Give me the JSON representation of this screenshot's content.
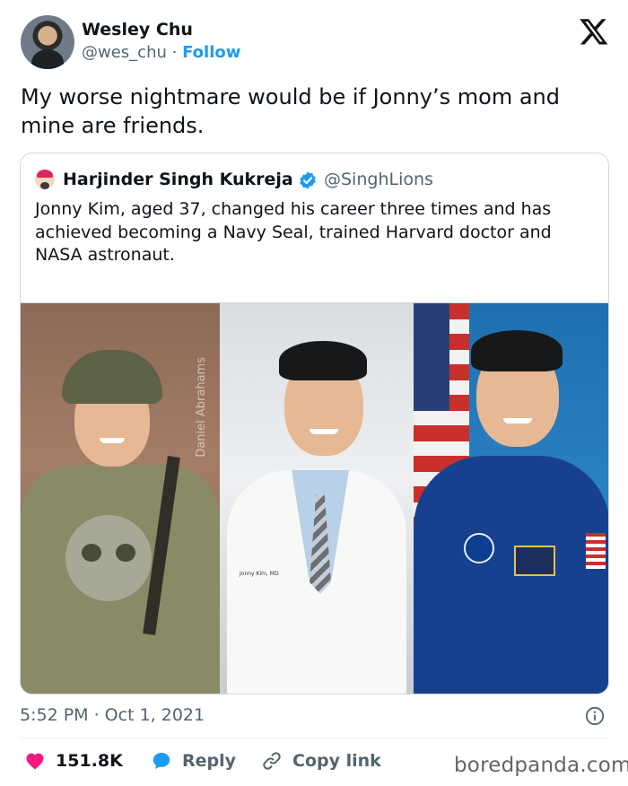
{
  "author": {
    "name": "Wesley Chu",
    "handle": "@wes_chu",
    "separator": "·",
    "follow_label": "Follow"
  },
  "tweet": {
    "text": "My worse nightmare would be if Jonny’s mom and mine are friends."
  },
  "quoted_tweet": {
    "name": "Harjinder Singh Kukreja",
    "handle": "@SinghLions",
    "text": "Jonny Kim, aged 37, changed his career three times and has achieved becoming a Navy Seal, trained Harvard doctor and NASA astronaut.",
    "photo_watermark": "Daniel Abrahams",
    "coat_label": "Jonny Kim, MD"
  },
  "meta": {
    "timestamp": "5:52 PM · Oct 1, 2021"
  },
  "actions": {
    "likes_count": "151.8K",
    "reply_label": "Reply",
    "copy_link_label": "Copy link"
  },
  "brand": "boredpanda.com",
  "colors": {
    "accent": "#1d9bf0",
    "like": "#f91880",
    "text_primary": "#0f1419",
    "text_secondary": "#536471"
  },
  "icons": [
    "x-logo-icon",
    "verified-badge-icon",
    "info-icon",
    "heart-icon",
    "reply-bubble-icon",
    "link-icon"
  ]
}
